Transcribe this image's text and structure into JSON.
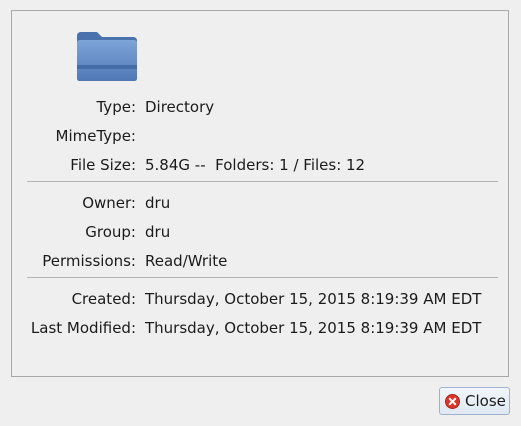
{
  "properties": {
    "type": {
      "label": "Type:",
      "value": "Directory"
    },
    "mimetype": {
      "label": "MimeType:",
      "value": ""
    },
    "file_size": {
      "label": "File Size:",
      "value": "5.84G --  Folders: 1 / Files: 12"
    },
    "owner": {
      "label": "Owner:",
      "value": "dru"
    },
    "group": {
      "label": "Group:",
      "value": "dru"
    },
    "permissions": {
      "label": "Permissions:",
      "value": "Read/Write"
    },
    "created": {
      "label": "Created:",
      "value": "Thursday, October 15, 2015 8:19:39 AM EDT"
    },
    "last_modified": {
      "label": "Last Modified:",
      "value": "Thursday, October 15, 2015 8:19:39 AM EDT"
    }
  },
  "icon": "folder-icon",
  "buttons": {
    "close_label": "Close"
  },
  "colors": {
    "folder": "#5b86c4",
    "close_icon": "#d9362b"
  }
}
